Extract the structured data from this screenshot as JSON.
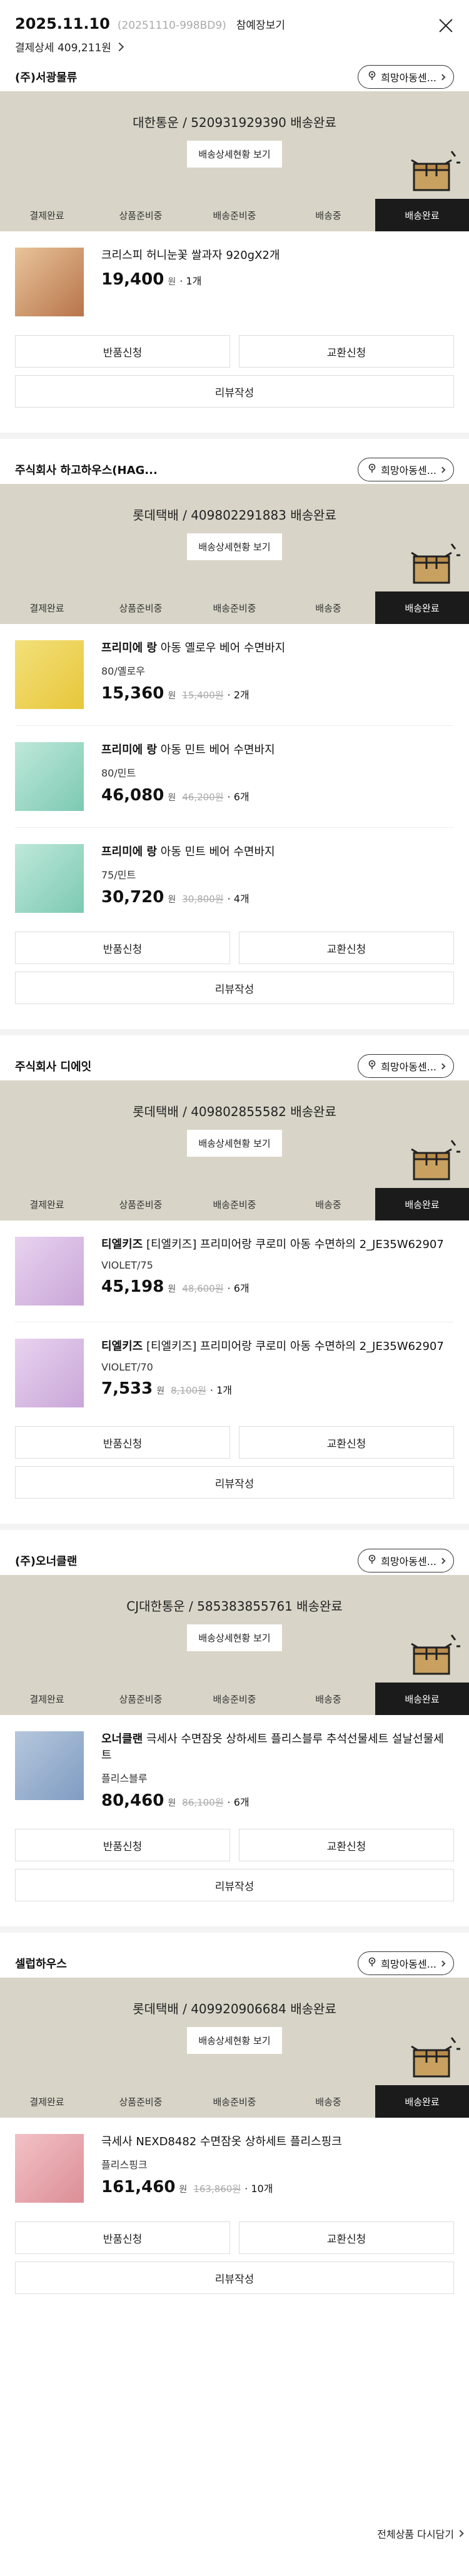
{
  "header": {
    "date": "2025.11.10",
    "order_no": "(20251110-998BD9)",
    "preview": "참예장보기",
    "payment": "결제상세 409,211원"
  },
  "labels": {
    "hope_center": "희망아동센...",
    "ship_status_btn": "배송상세현황 보기",
    "return": "반품신청",
    "exchange": "교환신청",
    "review": "리뷰작성",
    "currency": "원",
    "reorder": "전체상품 다시담기"
  },
  "steps": [
    "결제완료",
    "상품준비중",
    "배송준비중",
    "배송중",
    "배송완료"
  ],
  "sellers": [
    {
      "name": "(주)서광물류",
      "shipment": "대한통운 / 520931929390 배송완료",
      "items": [
        {
          "brand": "",
          "name": "크리스피 허니눈꽃 쌀과자 920gX2개",
          "option": "",
          "price": "19,400",
          "orig": "",
          "qty": "· 1개"
        }
      ]
    },
    {
      "name": "주식회사 하고하우스(HAG...",
      "shipment": "롯데택배 / 409802291883 배송완료",
      "items": [
        {
          "brand": "프리미에 랑",
          "name": " 아동 옐로우 베어 수면바지",
          "option": "80/옐로우",
          "price": "15,360",
          "orig": "15,400원",
          "qty": "· 2개"
        },
        {
          "brand": "프리미에 랑",
          "name": " 아동 민트 베어 수면바지",
          "option": "80/민트",
          "price": "46,080",
          "orig": "46,200원",
          "qty": "· 6개"
        },
        {
          "brand": "프리미에 랑",
          "name": " 아동 민트 베어 수면바지",
          "option": "75/민트",
          "price": "30,720",
          "orig": "30,800원",
          "qty": "· 4개"
        }
      ]
    },
    {
      "name": "주식회사 디에잇",
      "shipment": "롯데택배 / 409802855582 배송완료",
      "items": [
        {
          "brand": "티엘키즈",
          "name": " [티엘키즈] 프리미어랑 쿠로미 아동 수면하의 2_JE35W62907",
          "option": "VIOLET/75",
          "price": "45,198",
          "orig": "48,600원",
          "qty": "· 6개"
        },
        {
          "brand": "티엘키즈",
          "name": " [티엘키즈] 프리미어랑 쿠로미 아동 수면하의 2_JE35W62907",
          "option": "VIOLET/70",
          "price": "7,533",
          "orig": "8,100원",
          "qty": "· 1개"
        }
      ]
    },
    {
      "name": "(주)오너클랜",
      "shipment": "CJ대한통운 / 585383855761 배송완료",
      "items": [
        {
          "brand": "오너클랜",
          "name": " 극세사 수면잠옷 상하세트 플리스블루 추석선물세트 설날선물세트",
          "option": "플리스블루",
          "price": "80,460",
          "orig": "86,100원",
          "qty": "· 6개"
        }
      ]
    },
    {
      "name": "셀럽하우스",
      "shipment": "롯데택배 / 409920906684 배송완료",
      "items": [
        {
          "brand": "",
          "name": "극세사 NEXD8482 수면잠옷 상하세트 플리스핑크",
          "option": "플리스핑크",
          "price": "161,460",
          "orig": "163,860원",
          "qty": "· 10개"
        }
      ]
    }
  ],
  "colors": {
    "banner": "#d8d4c7",
    "active_step": "#1b1b1b",
    "box": "#c8a060"
  }
}
